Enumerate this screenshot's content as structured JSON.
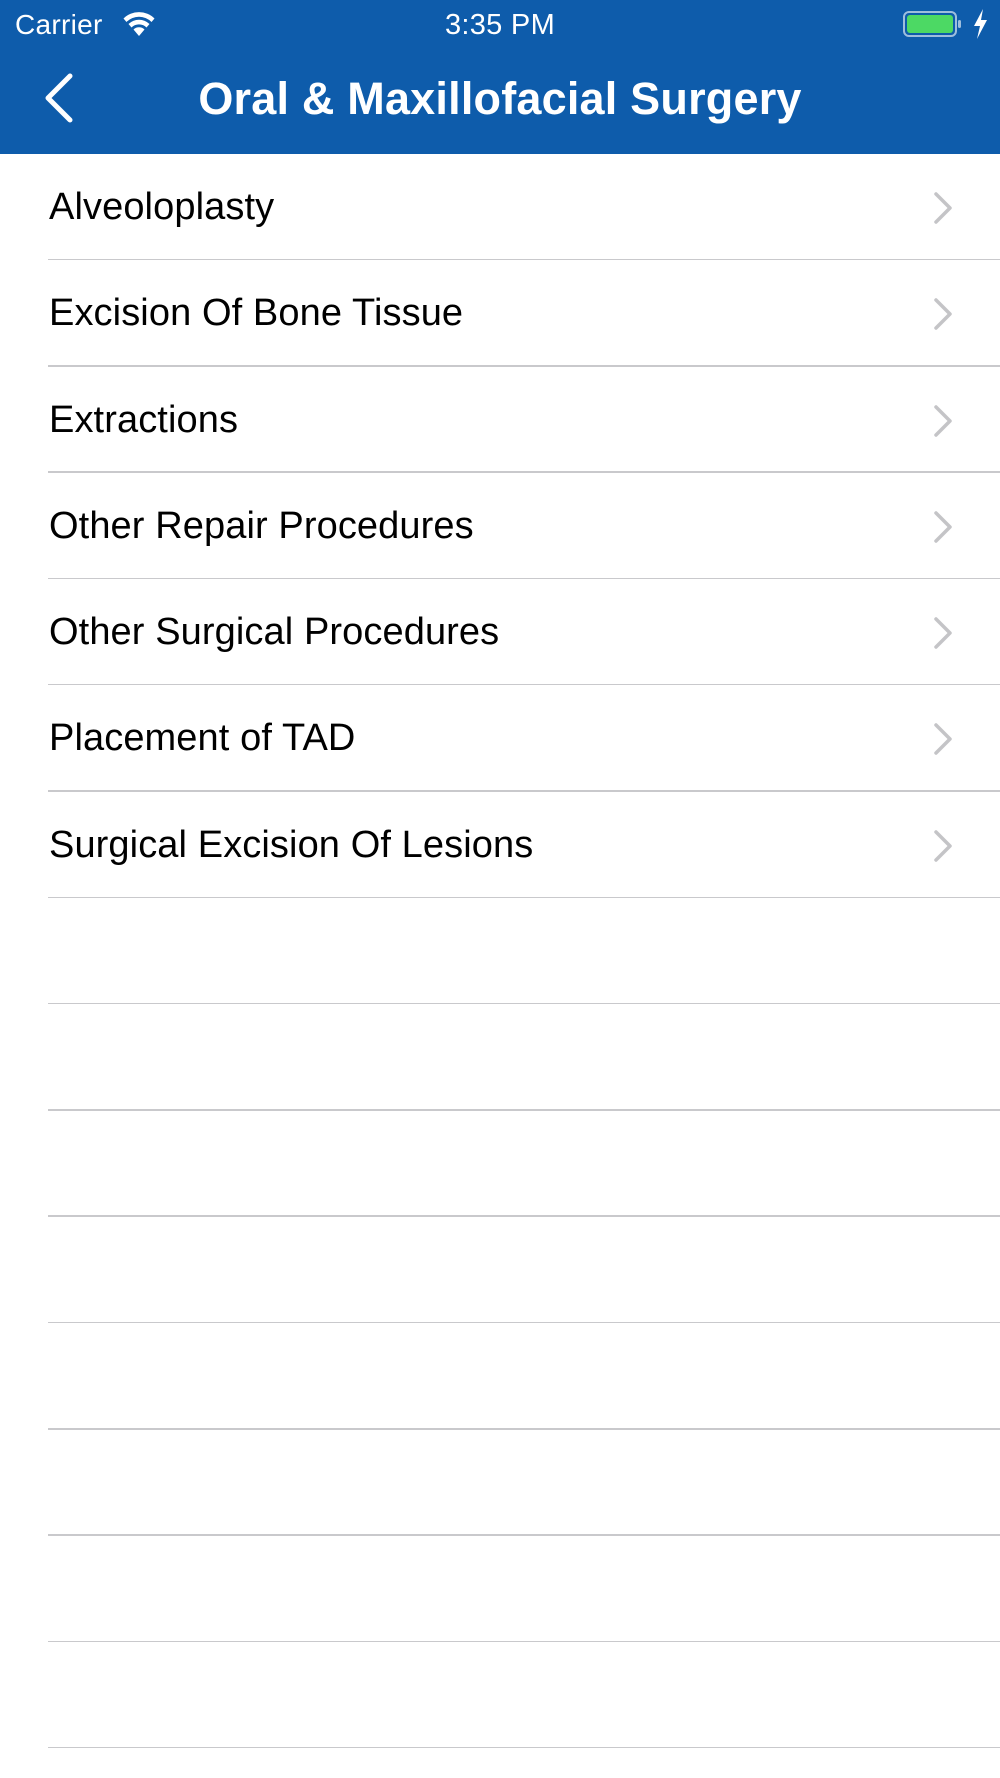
{
  "status_bar": {
    "carrier": "Carrier",
    "time": "3:35 PM",
    "battery_color": "#4cd964",
    "wifi_icon": "wifi-icon",
    "battery_icon": "battery-icon",
    "charging_icon": "charging-bolt-icon"
  },
  "nav": {
    "title": "Oral & Maxillofacial Surgery",
    "back_icon": "chevron-left-icon",
    "background_color": "#0e5cab"
  },
  "list": {
    "items": [
      {
        "label": "Alveoloplasty"
      },
      {
        "label": "Excision Of Bone Tissue"
      },
      {
        "label": "Extractions"
      },
      {
        "label": "Other Repair Procedures"
      },
      {
        "label": "Other Surgical Procedures"
      },
      {
        "label": "Placement of TAD"
      },
      {
        "label": "Surgical Excision Of Lesions"
      }
    ],
    "disclosure_icon": "chevron-right-icon"
  }
}
